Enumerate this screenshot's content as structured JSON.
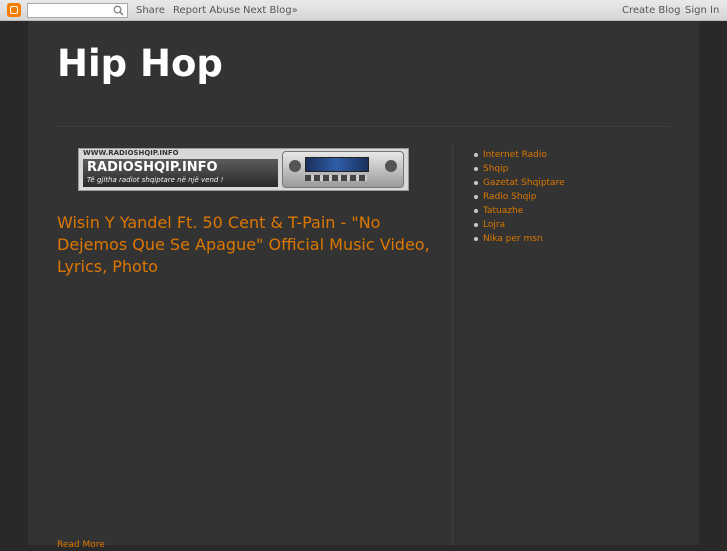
{
  "navbar": {
    "logo": "blogger-logo-icon",
    "search_placeholder": "",
    "links_left": [
      "Share",
      "Report Abuse",
      "Next Blog»"
    ],
    "links_right": [
      "Create Blog",
      "Sign In"
    ]
  },
  "header": {
    "title": "Hip Hop"
  },
  "banner": {
    "url_text": "WWW.RADIOSHQIP.INFO",
    "name": "RADIOSHQIP.INFO",
    "tagline": "Të gjitha radiot shqiptare në një vend !"
  },
  "post": {
    "title": "Wisin Y Yandel Ft. 50 Cent & T-Pain - \"No Dejemos Que Se Apague\" Official Music Video, Lyrics, Photo",
    "read_more": "Read More"
  },
  "sidebar": {
    "links": [
      "Internet Radio",
      "Shqip",
      "Gazetat Shqiptare",
      "Radio Shqip",
      "Tatuazhe",
      "Lojra",
      "Nika per msn"
    ]
  },
  "colors": {
    "background": "#292929",
    "content": "#333333",
    "accent": "#dd7700",
    "title": "#ffffff"
  }
}
